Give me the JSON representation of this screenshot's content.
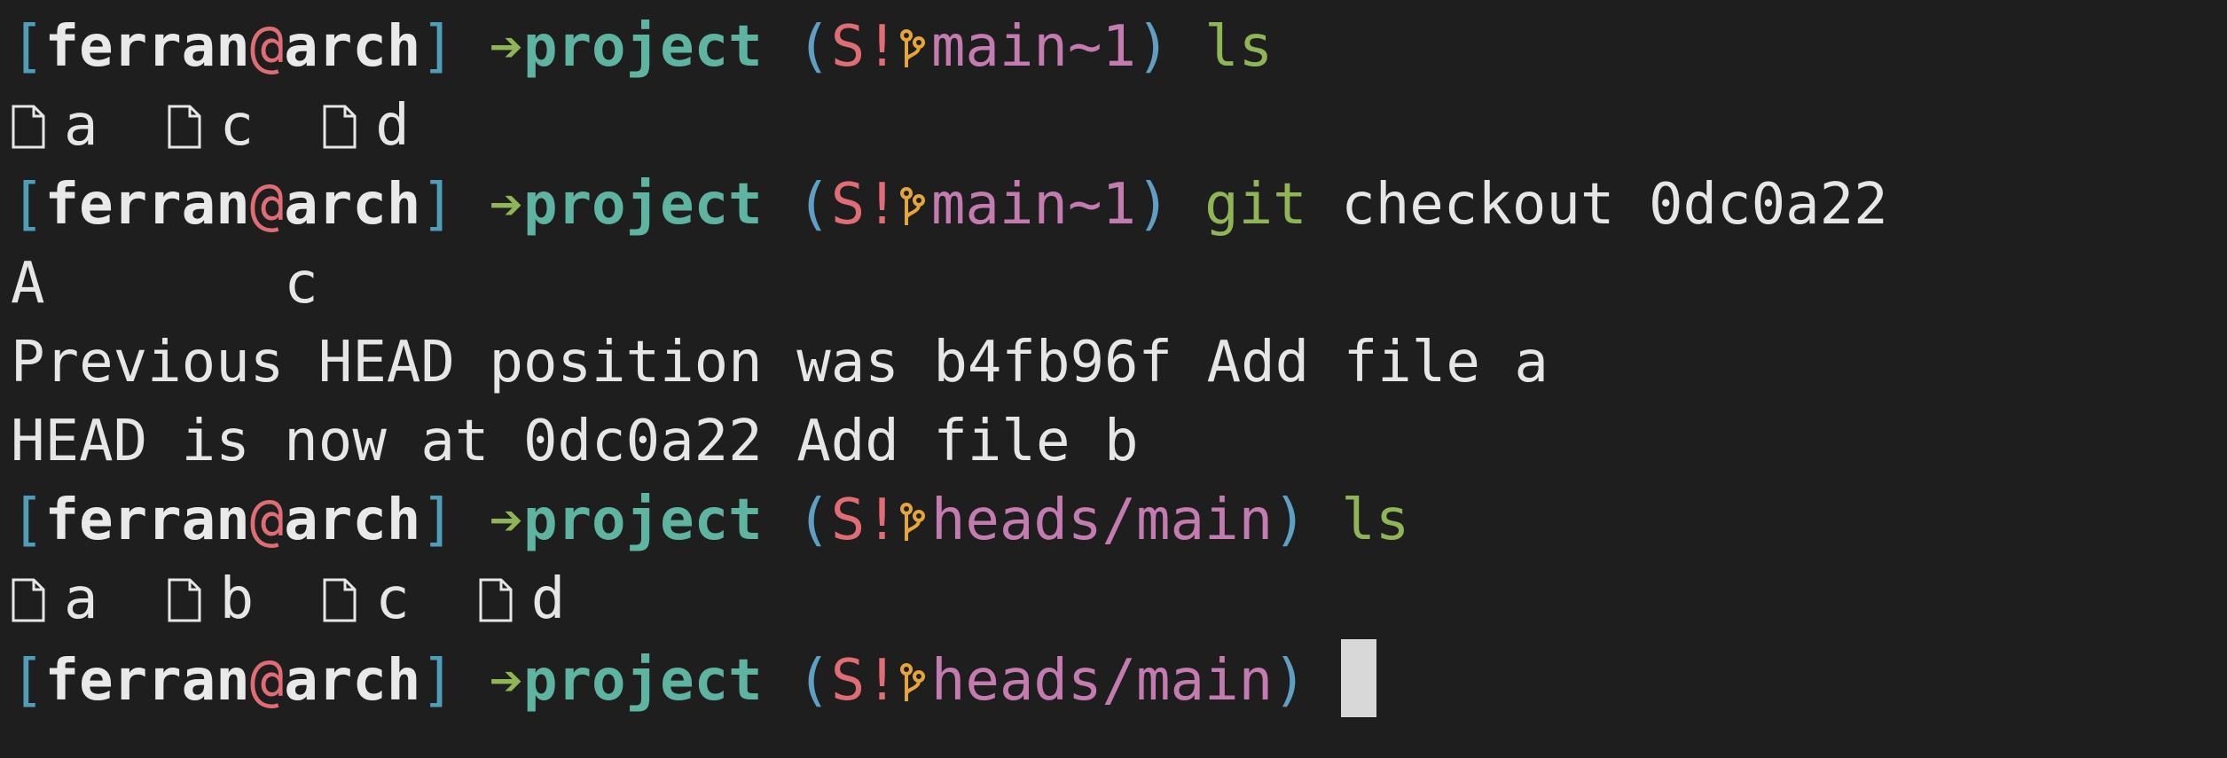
{
  "prompt": {
    "bracket_open": "[",
    "user": "ferran",
    "at": "@",
    "host": "arch",
    "bracket_close": "]",
    "arrow": "➔",
    "dir": "project",
    "paren_open": "(",
    "status": "S!",
    "branch_icon": "branch-icon",
    "paren_close": ")"
  },
  "lines": [
    {
      "type": "prompt",
      "branch": "main~1",
      "cmd": "ls",
      "args": ""
    },
    {
      "type": "files",
      "files": [
        "a",
        "c",
        "d"
      ]
    },
    {
      "type": "prompt",
      "branch": "main~1",
      "cmd": "git",
      "args": "checkout 0dc0a22"
    },
    {
      "type": "output",
      "text": "A       c"
    },
    {
      "type": "output",
      "text": "Previous HEAD position was b4fb96f Add file a"
    },
    {
      "type": "output",
      "text": "HEAD is now at 0dc0a22 Add file b"
    },
    {
      "type": "prompt",
      "branch": "heads/main",
      "cmd": "ls",
      "args": ""
    },
    {
      "type": "files",
      "files": [
        "a",
        "b",
        "c",
        "d"
      ]
    },
    {
      "type": "prompt",
      "branch": "heads/main",
      "cmd": "",
      "args": "",
      "cursor": true
    }
  ],
  "colors": {
    "background": "#1e1e1e",
    "bracket": "#4f9db9",
    "at": "#e06c75",
    "arrow": "#8fb557",
    "dir": "#5fb3a1",
    "status": "#e06c75",
    "branch_icon": "#e5a53a",
    "branch": "#c37bb0",
    "command": "#8fb557"
  }
}
